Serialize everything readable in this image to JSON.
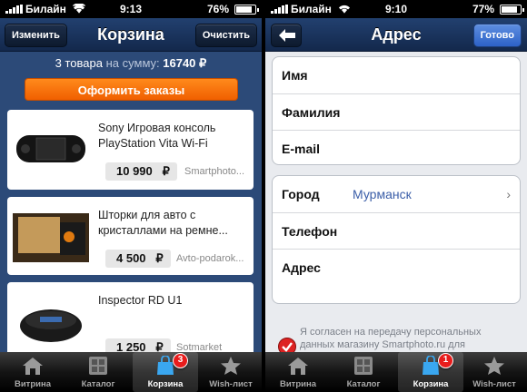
{
  "left": {
    "status": {
      "carrier": "Билайн",
      "time": "9:13",
      "battery": "76%",
      "battery_level": 0.76
    },
    "nav": {
      "title": "Корзина",
      "edit": "Изменить",
      "clear": "Очистить"
    },
    "summary": {
      "count": "3 товара",
      "label": "на сумму:",
      "total": "16740",
      "currency": "₽"
    },
    "order_button": "Оформить заказы",
    "products": [
      {
        "name": "Sony Игровая консоль PlayStation Vita Wi-Fi",
        "price": "10 990",
        "currency": "₽",
        "store": "Smartphoto..."
      },
      {
        "name": "Шторки для авто с кристаллами на ремне...",
        "price": "4 500",
        "currency": "₽",
        "store": "Avto-podarok..."
      },
      {
        "name": "Inspector RD U1",
        "price": "1 250",
        "currency": "₽",
        "store": "Sotmarket"
      }
    ],
    "tabs": [
      {
        "label": "Витрина",
        "icon": "house-icon"
      },
      {
        "label": "Каталог",
        "icon": "catalog-icon"
      },
      {
        "label": "Корзина",
        "icon": "shopping-bag-icon",
        "badge": "3"
      },
      {
        "label": "Wish-лист",
        "icon": "star-icon"
      }
    ]
  },
  "right": {
    "status": {
      "carrier": "Билайн",
      "time": "9:10",
      "battery": "77%",
      "battery_level": 0.77
    },
    "nav": {
      "title": "Адрес",
      "done": "Готово"
    },
    "group1": [
      {
        "label": "Имя"
      },
      {
        "label": "Фамилия"
      },
      {
        "label": "E-mail"
      }
    ],
    "group2": [
      {
        "label": "Город",
        "value": "Мурманск"
      },
      {
        "label": "Телефон"
      },
      {
        "label": "Адрес"
      }
    ],
    "consent": "Я согласен на передачу персональных данных магазину Smartphoto.ru для",
    "tabs": [
      {
        "label": "Витрина",
        "icon": "house-icon"
      },
      {
        "label": "Каталог",
        "icon": "catalog-icon"
      },
      {
        "label": "Корзина",
        "icon": "shopping-bag-icon",
        "badge": "1"
      },
      {
        "label": "Wish-лист",
        "icon": "star-icon"
      }
    ]
  },
  "colors": {
    "nav": "#1a3460",
    "accent_orange": "#f26b0c",
    "badge_red": "#e81c1c",
    "done_blue": "#3a6fd4"
  }
}
